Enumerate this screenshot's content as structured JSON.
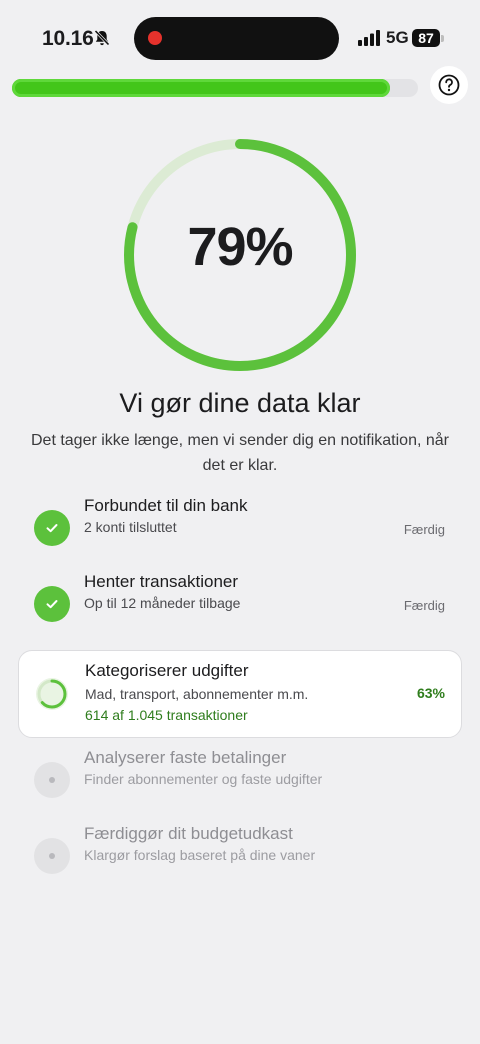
{
  "status_bar": {
    "time": "10.16",
    "network": "5G",
    "battery": "87"
  },
  "top_progress": {
    "fraction": 0.93
  },
  "progress": {
    "percent_label": "79%",
    "fraction": 0.79
  },
  "title": "Vi gør dine data klar",
  "subtitle": "Det tager ikke længe, men vi sender dig en notifikation, når det er klar.",
  "steps": [
    {
      "title": "Forbundet til din bank",
      "subtitle": "2 konti tilsluttet",
      "status": "Færdig",
      "state": "done"
    },
    {
      "title": "Henter transaktioner",
      "subtitle": "Op til 12 måneder tilbage",
      "status": "Færdig",
      "state": "done"
    },
    {
      "title": "Kategoriserer udgifter",
      "subtitle": "Mad, transport, abonnementer m.m.",
      "detail": "614 af 1.045 transaktioner",
      "percent_label": "63%",
      "fraction": 0.63,
      "state": "active"
    },
    {
      "title": "Analyserer faste betalinger",
      "subtitle": "Finder abonnementer og faste udgifter",
      "state": "pending"
    },
    {
      "title": "Færdiggør dit budgetudkast",
      "subtitle": "Klargør forslag baseret på dine vaner",
      "state": "pending"
    }
  ],
  "colors": {
    "accent": "#5cc13c",
    "accent_light": "#dcebd4",
    "accent_text": "#2f7d1d"
  },
  "icons": {
    "help": "question-circle-icon",
    "done": "check-icon",
    "silent": "bell-slash-icon"
  }
}
